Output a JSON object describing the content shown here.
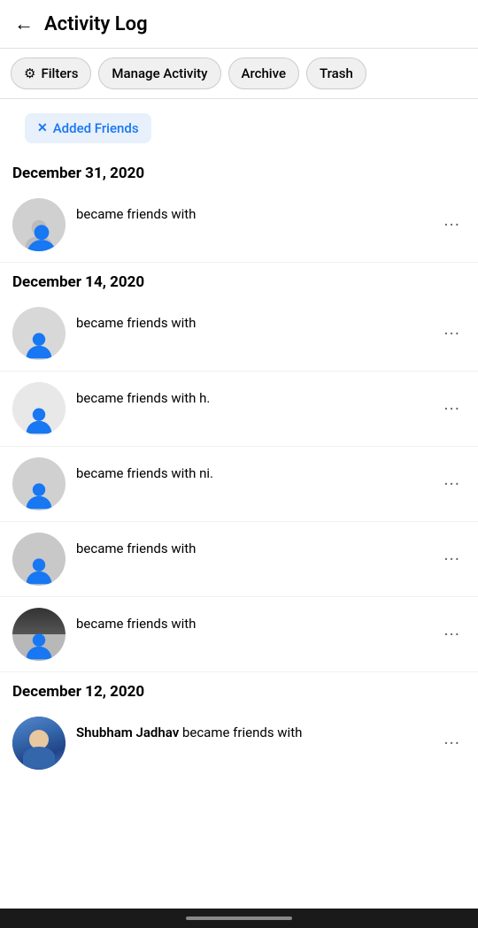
{
  "header": {
    "back_label": "←",
    "title": "Activity Log"
  },
  "filterBar": {
    "filters": [
      {
        "id": "filters",
        "label": "Filters",
        "icon": "⚙"
      },
      {
        "id": "manage-activity",
        "label": "Manage Activity",
        "icon": ""
      },
      {
        "id": "archive",
        "label": "Archive",
        "icon": ""
      },
      {
        "id": "trash",
        "label": "Trash",
        "icon": ""
      }
    ]
  },
  "activeFilter": {
    "x": "✕",
    "label": "Added Friends"
  },
  "sections": [
    {
      "date": "December 31, 2020",
      "items": [
        {
          "name": "",
          "action": "became friends with",
          "hasAvatar": true,
          "avatarType": "default"
        }
      ]
    },
    {
      "date": "December 14, 2020",
      "items": [
        {
          "name": "",
          "action": "became friends with",
          "hasAvatar": true,
          "avatarType": "partial"
        },
        {
          "name": "",
          "action": "became friends with h.",
          "hasAvatar": true,
          "avatarType": "partial2"
        },
        {
          "name": "",
          "action": "became friends with ni.",
          "hasAvatar": true,
          "avatarType": "partial3"
        },
        {
          "name": "",
          "action": "became friends with",
          "hasAvatar": true,
          "avatarType": "partial4"
        },
        {
          "name": "",
          "action": "became friends with",
          "hasAvatar": true,
          "avatarType": "partial5"
        }
      ]
    },
    {
      "date": "December 12, 2020",
      "items": [
        {
          "name": "Shubham Jadhav",
          "action": "became friends with",
          "hasAvatar": true,
          "avatarType": "photo"
        }
      ]
    }
  ],
  "moreButtonLabel": "•••"
}
